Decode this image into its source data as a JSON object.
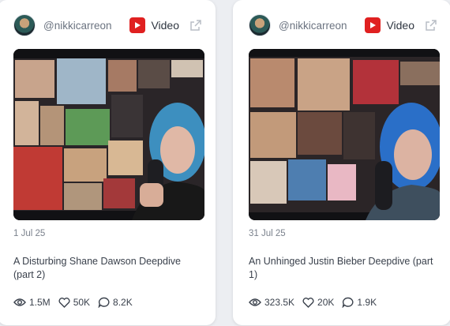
{
  "cards": [
    {
      "author_handle": "@nikkicarreon",
      "type_label": "Video",
      "type_icon": "youtube-icon",
      "date": "1 Jul 25",
      "title": "A Disturbing Shane Dawson Deepdive (part 2)",
      "stats": {
        "views": "1.5M",
        "likes": "50K",
        "comments": "8.2K"
      }
    },
    {
      "author_handle": "@nikkicarreon",
      "type_label": "Video",
      "type_icon": "youtube-icon",
      "date": "31 Jul 25",
      "title": "An Unhinged Justin Bieber Deepdive (part 1)",
      "stats": {
        "views": "323.5K",
        "likes": "20K",
        "comments": "1.9K"
      }
    }
  ],
  "colors": {
    "youtube_red": "#e02020",
    "card_bg": "#ffffff",
    "page_bg": "#eceef2"
  }
}
